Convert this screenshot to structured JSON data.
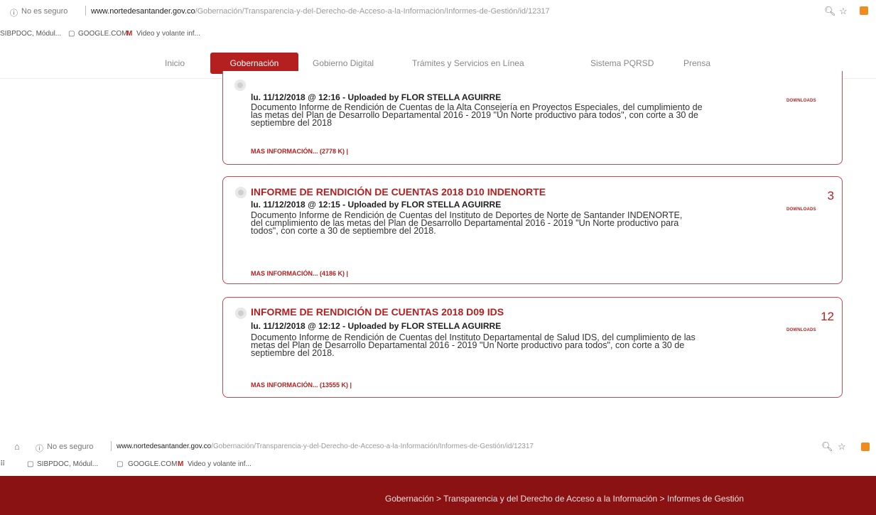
{
  "browser": {
    "insecure_label": "No es seguro",
    "url_domain": "www.nortedesantander.gov.co",
    "url_path": "/Gobernación/Transparencia-y-del-Derecho-de-Acceso-a-la-Información/Informes-de-Gestión/id/12317",
    "bookmarks": [
      {
        "label": "SIBPDOC, Módul..."
      },
      {
        "label": "GOOGLE.COM"
      },
      {
        "label": "Video y volante inf..."
      }
    ],
    "accent_color": "#ef8c1e"
  },
  "nav": {
    "items": [
      {
        "label": "Inicio"
      },
      {
        "label": "Gobernación",
        "active": true
      },
      {
        "label": "Gobierno Digital"
      },
      {
        "label": "Trámites y Servicios en Línea"
      },
      {
        "label": "Sistema PQRSD"
      },
      {
        "label": "Prensa"
      }
    ],
    "active_color": "#b41f1f"
  },
  "cards": [
    {
      "title": "",
      "meta": "lu. 11/12/2018 @ 12:16 - Uploaded by FLOR STELLA AGUIRRE",
      "description": "Documento Informe de Rendición de Cuentas de la Alta Consejería en Proyectos Especiales, del cumplimiento de las metas del Plan de Desarrollo Departamental 2016 - 2019 \"Un Norte productivo para todos\", con corte a 30 de septiembre del 2018",
      "more_label": "MAS INFORMACIÓN...",
      "size": "(2778 K)",
      "count": "",
      "download_label": "DOWNLOADS"
    },
    {
      "title": "INFORME DE RENDICIÓN DE CUENTAS 2018 D10 INDENORTE",
      "meta": "lu. 11/12/2018 @ 12:15 - Uploaded by FLOR STELLA AGUIRRE",
      "description": "Documento Informe de Rendición de Cuentas del Instituto de Deportes de Norte de Santander INDENORTE, del cumplimiento de las metas del Plan de Desarrollo Departamental 2016 - 2019 \"Un Norte productivo para todos\", con corte a 30 de septiembre del 2018.",
      "more_label": "MAS INFORMACIÓN...",
      "size": "(4186 K)",
      "count": "3",
      "download_label": "DOWNLOADS"
    },
    {
      "title": "INFORME DE RENDICIÓN DE CUENTAS 2018 D09 IDS",
      "meta": "lu. 11/12/2018 @ 12:12 - Uploaded by FLOR STELLA AGUIRRE",
      "description": "Documento Informe de Rendición de Cuentas del Instituto Departamental de Salud IDS, del cumplimiento de las metas del Plan de Desarrollo Departamental 2016 - 2019 \"Un Norte productivo para todos\", con corte a 30 de septiembre del 2018.",
      "more_label": "MAS INFORMACIÓN...",
      "size": "(13555 K)",
      "count": "12",
      "download_label": "DOWNLOADS"
    }
  ],
  "breadcrumb": {
    "text": "Gobernación > Transparencia y del Derecho de Acceso a la Información > Informes de Gestión"
  },
  "colors": {
    "card_border": "#c9484b",
    "band": "#8b1212"
  }
}
